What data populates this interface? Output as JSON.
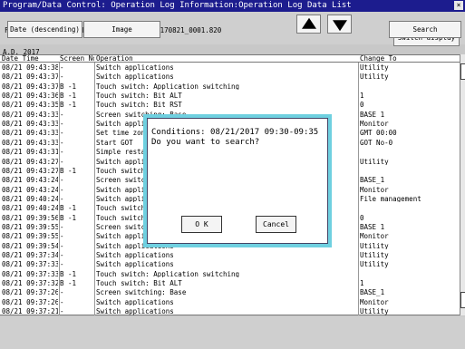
{
  "window": {
    "title": "Program/Data Control: Operation Log Information:Operation Log Data List",
    "close_glyph": "×"
  },
  "file": {
    "text": "File Name  A:\\PACKAGE1\\OPELOG\\OPELOG_20170821_0001.820"
  },
  "toolbar": {
    "switch_display_label": "Switch display"
  },
  "year": "A.D. 2017",
  "table": {
    "headers": {
      "date_time": "Date  Time",
      "screen_no": "Screen No.",
      "operation": "Operation",
      "change_to": "Change To"
    },
    "rows": [
      {
        "dt": "08/21 09:43:38",
        "sn": "-",
        "op": "Switch applications",
        "ct": "Utility"
      },
      {
        "dt": "08/21 09:43:37",
        "sn": "-",
        "op": "Switch applications",
        "ct": "Utility"
      },
      {
        "dt": "08/21 09:43:37",
        "sn": "B -1",
        "op": "Touch switch: Application switching",
        "ct": ""
      },
      {
        "dt": "08/21 09:43:36",
        "sn": "B -1",
        "op": "Touch switch: Bit ALT",
        "ct": "1"
      },
      {
        "dt": "08/21 09:43:35",
        "sn": "B -1",
        "op": "Touch switch: Bit RST",
        "ct": "0"
      },
      {
        "dt": "08/21 09:43:33",
        "sn": "-",
        "op": "Screen switching: Base",
        "ct": "BASE_1"
      },
      {
        "dt": "08/21 09:43:33",
        "sn": "-",
        "op": "Switch applications",
        "ct": "Monitor"
      },
      {
        "dt": "08/21 09:43:33",
        "sn": "-",
        "op": "Set time zone",
        "ct": "GMT 00:00"
      },
      {
        "dt": "08/21 09:43:33",
        "sn": "-",
        "op": "Start GOT",
        "ct": "GOT_No-0"
      },
      {
        "dt": "08/21 09:43:31",
        "sn": "-",
        "op": "Simple restart",
        "ct": ""
      },
      {
        "dt": "08/21 09:43:27",
        "sn": "-",
        "op": "Switch applications",
        "ct": "Utility"
      },
      {
        "dt": "08/21 09:43:27",
        "sn": "B -1",
        "op": "Touch switch:",
        "ct": ""
      },
      {
        "dt": "08/21 09:43:24",
        "sn": "-",
        "op": "Screen switching",
        "ct": "BASE_1"
      },
      {
        "dt": "08/21 09:43:24",
        "sn": "-",
        "op": "Switch applications",
        "ct": "Monitor"
      },
      {
        "dt": "08/21 09:40:24",
        "sn": "-",
        "op": "Switch applications",
        "ct": "File management"
      },
      {
        "dt": "08/21 09:40:24",
        "sn": "B -1",
        "op": "Touch switch:",
        "ct": ""
      },
      {
        "dt": "08/21 09:39:56",
        "sn": "B -1",
        "op": "Touch switch:",
        "ct": "0"
      },
      {
        "dt": "08/21 09:39:55",
        "sn": "-",
        "op": "Screen switching",
        "ct": "BASE_1"
      },
      {
        "dt": "08/21 09:39:55",
        "sn": "-",
        "op": "Switch applications",
        "ct": "Monitor"
      },
      {
        "dt": "08/21 09:39:54",
        "sn": "-",
        "op": "Switch applications",
        "ct": "Utility"
      },
      {
        "dt": "08/21 09:37:34",
        "sn": "-",
        "op": "Switch applications",
        "ct": "Utility"
      },
      {
        "dt": "08/21 09:37:33",
        "sn": "-",
        "op": "Switch applications",
        "ct": "Utility"
      },
      {
        "dt": "08/21 09:37:33",
        "sn": "B -1",
        "op": "Touch switch: Application switching",
        "ct": ""
      },
      {
        "dt": "08/21 09:37:32",
        "sn": "B -1",
        "op": "Touch switch: Bit ALT",
        "ct": "1"
      },
      {
        "dt": "08/21 09:37:26",
        "sn": "-",
        "op": "Screen switching: Base",
        "ct": "BASE_1"
      },
      {
        "dt": "08/21 09:37:26",
        "sn": "-",
        "op": "Switch applications",
        "ct": "Monitor"
      },
      {
        "dt": "08/21 09:37:21",
        "sn": "-",
        "op": "Switch applications",
        "ct": "Utility"
      }
    ]
  },
  "dialog": {
    "line1": "Conditions:  08/21/2017 09:30-09:35",
    "line2": "Do you want to search?",
    "ok_label": "O K",
    "cancel_label": "Cancel"
  },
  "bottom": {
    "date_sort_label": "Date (descending)",
    "image_label": "Image",
    "search_label": "Search"
  }
}
